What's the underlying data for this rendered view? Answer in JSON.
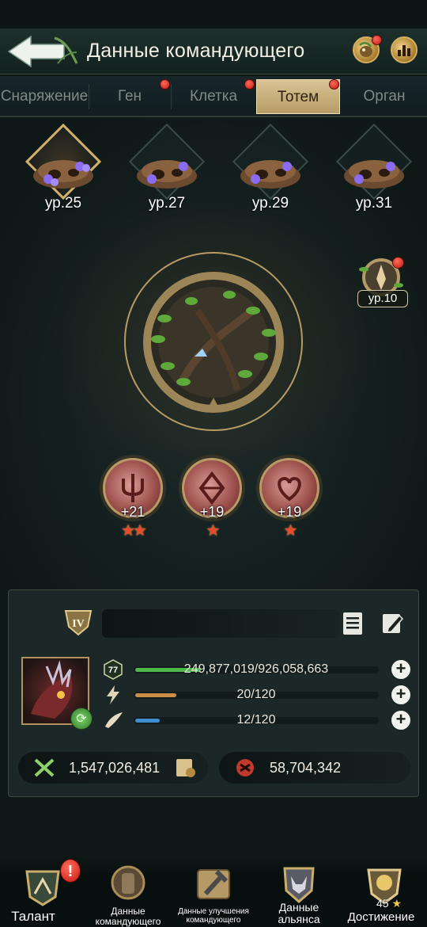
{
  "header": {
    "title": "Данные командующего",
    "back_icon": "back-arrow-icon",
    "pet_icon": "pet-icon",
    "stats_icon": "chart-icon"
  },
  "tabs": [
    {
      "label": "Снаряжение",
      "active": false,
      "alert": false
    },
    {
      "label": "Ген",
      "active": false,
      "alert": true
    },
    {
      "label": "Клетка",
      "active": false,
      "alert": true
    },
    {
      "label": "Тотем",
      "active": true,
      "alert": true
    },
    {
      "label": "Орган",
      "active": false,
      "alert": false
    }
  ],
  "totem_slots": [
    {
      "level": "ур.25",
      "selected": true
    },
    {
      "level": "ур.27",
      "selected": false
    },
    {
      "level": "ур.29",
      "selected": false
    },
    {
      "level": "ур.31",
      "selected": false
    }
  ],
  "side_totem": {
    "level": "ур.10",
    "alert": true
  },
  "attributes": [
    {
      "value": "+21",
      "stars": 2,
      "icon": "trident-rune-icon"
    },
    {
      "value": "+19",
      "stars": 1,
      "icon": "diamond-rune-icon"
    },
    {
      "value": "+19",
      "stars": 1,
      "icon": "heart-rune-icon"
    }
  ],
  "commander": {
    "rank": "IV",
    "name": "",
    "stats": [
      {
        "icon": "level-77-icon",
        "level_label": "77",
        "text": "249,877,019/926,058,663",
        "progress": 0.27,
        "color": "#4cb84a"
      },
      {
        "icon": "lightning-icon",
        "text": "20/120",
        "progress": 0.17,
        "color": "#c98d45"
      },
      {
        "icon": "horn-icon",
        "text": "12/120",
        "progress": 0.1,
        "color": "#3d8fd0"
      }
    ],
    "attack_power": "1,547,026,481",
    "kills": "58,704,342"
  },
  "bottom_nav": [
    {
      "label": "Талант",
      "alert": "!"
    },
    {
      "label": "Данные командующего"
    },
    {
      "label": "Данные улучшения командующего"
    },
    {
      "label": "Данные альянса"
    },
    {
      "label": "Достижение",
      "count": "45"
    }
  ],
  "colors": {
    "accent_gold": "#d3b068",
    "alert_red": "#d4261b",
    "exp_green": "#4cb84a",
    "energy_orange": "#c98d45",
    "stamina_blue": "#3d8fd0"
  }
}
